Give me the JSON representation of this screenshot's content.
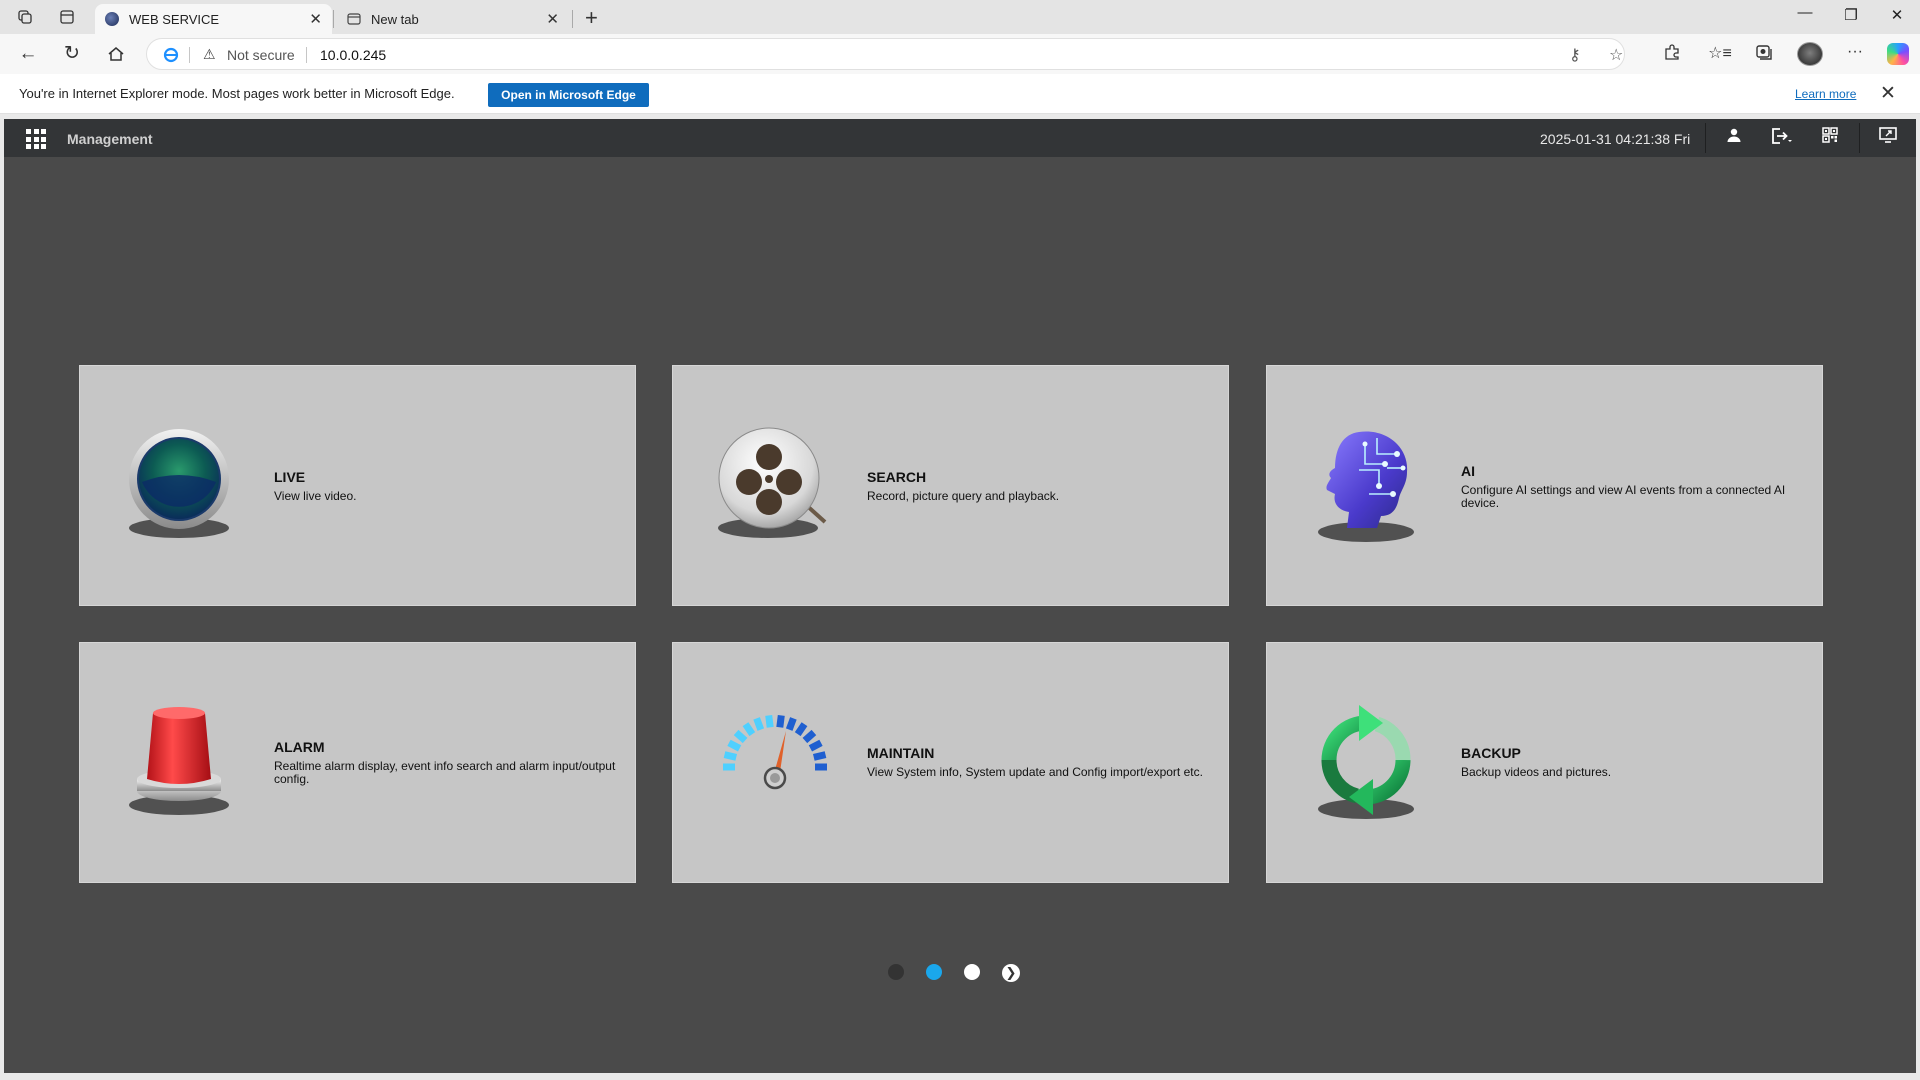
{
  "browser": {
    "tabs": [
      {
        "title": "WEB SERVICE",
        "active": true
      },
      {
        "title": "New tab",
        "active": false
      }
    ],
    "address": {
      "security_label": "Not secure",
      "url": "10.0.0.245"
    },
    "ie_mode_bar": {
      "message": "You're in Internet Explorer mode. Most pages work better in Microsoft Edge.",
      "open_button": "Open in Microsoft Edge",
      "learn_more": "Learn more"
    }
  },
  "app": {
    "title": "Management",
    "datetime": "2025-01-31 04:21:38 Fri",
    "header_icons": [
      "user-icon",
      "logout-icon",
      "qr-code-icon",
      "fullscreen-icon"
    ],
    "cards": [
      {
        "title": "LIVE",
        "description": "View live video.",
        "icon": "live-lens-icon"
      },
      {
        "title": "SEARCH",
        "description": "Record, picture query and playback.",
        "icon": "film-reel-icon"
      },
      {
        "title": "AI",
        "description": "Configure AI settings and view AI events from a connected AI device.",
        "icon": "ai-head-icon"
      },
      {
        "title": "ALARM",
        "description": "Realtime alarm display, event info search and alarm input/output config.",
        "icon": "alarm-siren-icon"
      },
      {
        "title": "MAINTAIN",
        "description": "View System info, System update and Config import/export etc.",
        "icon": "gauge-icon"
      },
      {
        "title": "BACKUP",
        "description": "Backup videos and pictures.",
        "icon": "refresh-arrows-icon"
      }
    ],
    "pager": {
      "page_count": 3,
      "current_page": 2,
      "colors": {
        "inactive_dark": "#333333",
        "active": "#1aa7ec",
        "inactive_light": "#ffffff"
      }
    }
  }
}
